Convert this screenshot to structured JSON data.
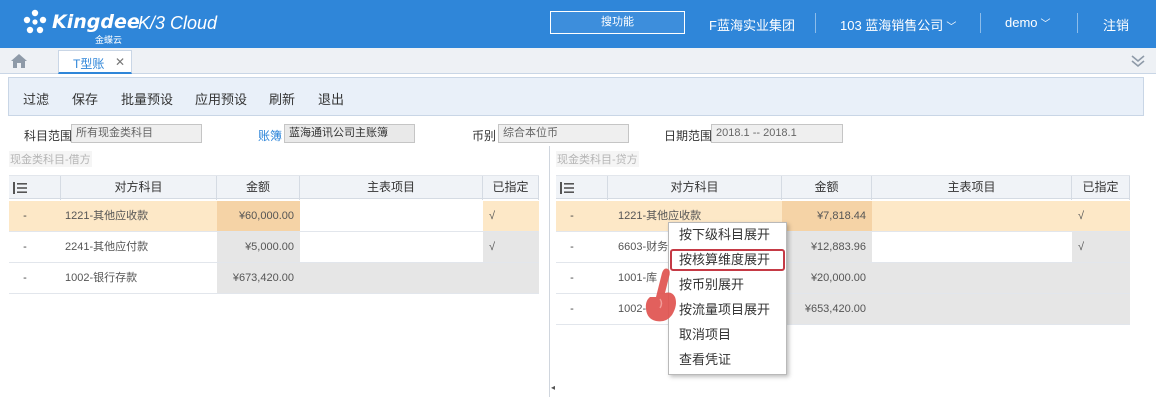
{
  "header": {
    "brand": "Kingdee",
    "brand_sub": "金蝶云",
    "product": "K/3 Cloud",
    "search_placeholder": "搜功能",
    "org_group": "F蓝海实业集团",
    "company": "103 蓝海销售公司",
    "user": "demo",
    "logout": "注销"
  },
  "tabs": [
    {
      "label": "T型账",
      "active": true
    }
  ],
  "toolbar": {
    "buttons": [
      "过滤",
      "保存",
      "批量预设",
      "应用预设",
      "刷新",
      "退出"
    ]
  },
  "filters": {
    "subject_range_label": "科目范围",
    "subject_range_value": "所有现金类科目",
    "ledger_label": "账簿",
    "ledger_value": "蓝海通讯公司主账簿",
    "currency_label": "币别",
    "currency_value": "综合本位币",
    "date_range_label": "日期范围",
    "date_range_value": "2018.1 -- 2018.1"
  },
  "debit_panel": {
    "title": "现金类科目-借方",
    "columns": [
      "对方科目",
      "金额",
      "主表项目",
      "已指定"
    ],
    "rows": [
      {
        "marker": "-",
        "account": "1221-其他应收款",
        "amount": "¥60,000.00",
        "main_item": "",
        "specified": "√",
        "selected": true
      },
      {
        "marker": "-",
        "account": "2241-其他应付款",
        "amount": "¥5,000.00",
        "main_item": "",
        "specified": "√",
        "selected": false
      },
      {
        "marker": "-",
        "account": "1002-银行存款",
        "amount": "¥673,420.00",
        "main_item": "",
        "specified": "",
        "selected": false
      }
    ]
  },
  "credit_panel": {
    "title": "现金类科目-贷方",
    "columns": [
      "对方科目",
      "金额",
      "主表项目",
      "已指定"
    ],
    "rows": [
      {
        "marker": "-",
        "account": "1221-其他应收款",
        "amount": "¥7,818.44",
        "main_item": "",
        "specified": "√",
        "selected": true
      },
      {
        "marker": "-",
        "account": "6603-财务",
        "amount": "¥12,883.96",
        "main_item": "",
        "specified": "√",
        "selected": false
      },
      {
        "marker": "-",
        "account": "1001-库",
        "amount": "¥20,000.00",
        "main_item": "",
        "specified": "",
        "selected": false
      },
      {
        "marker": "-",
        "account": "1002-",
        "amount": "¥653,420.00",
        "main_item": "",
        "specified": "",
        "selected": false
      }
    ]
  },
  "context_menu": {
    "items": [
      "按下级科目展开",
      "按核算维度展开",
      "按币别展开",
      "按流量项目展开",
      "取消项目",
      "查看凭证"
    ],
    "highlighted_index": 1
  },
  "colors": {
    "header_bg": "#2f86d9",
    "selected_row": "#fde8c7",
    "highlight_border": "#c53a45",
    "hand_pointer": "#e0524f"
  }
}
